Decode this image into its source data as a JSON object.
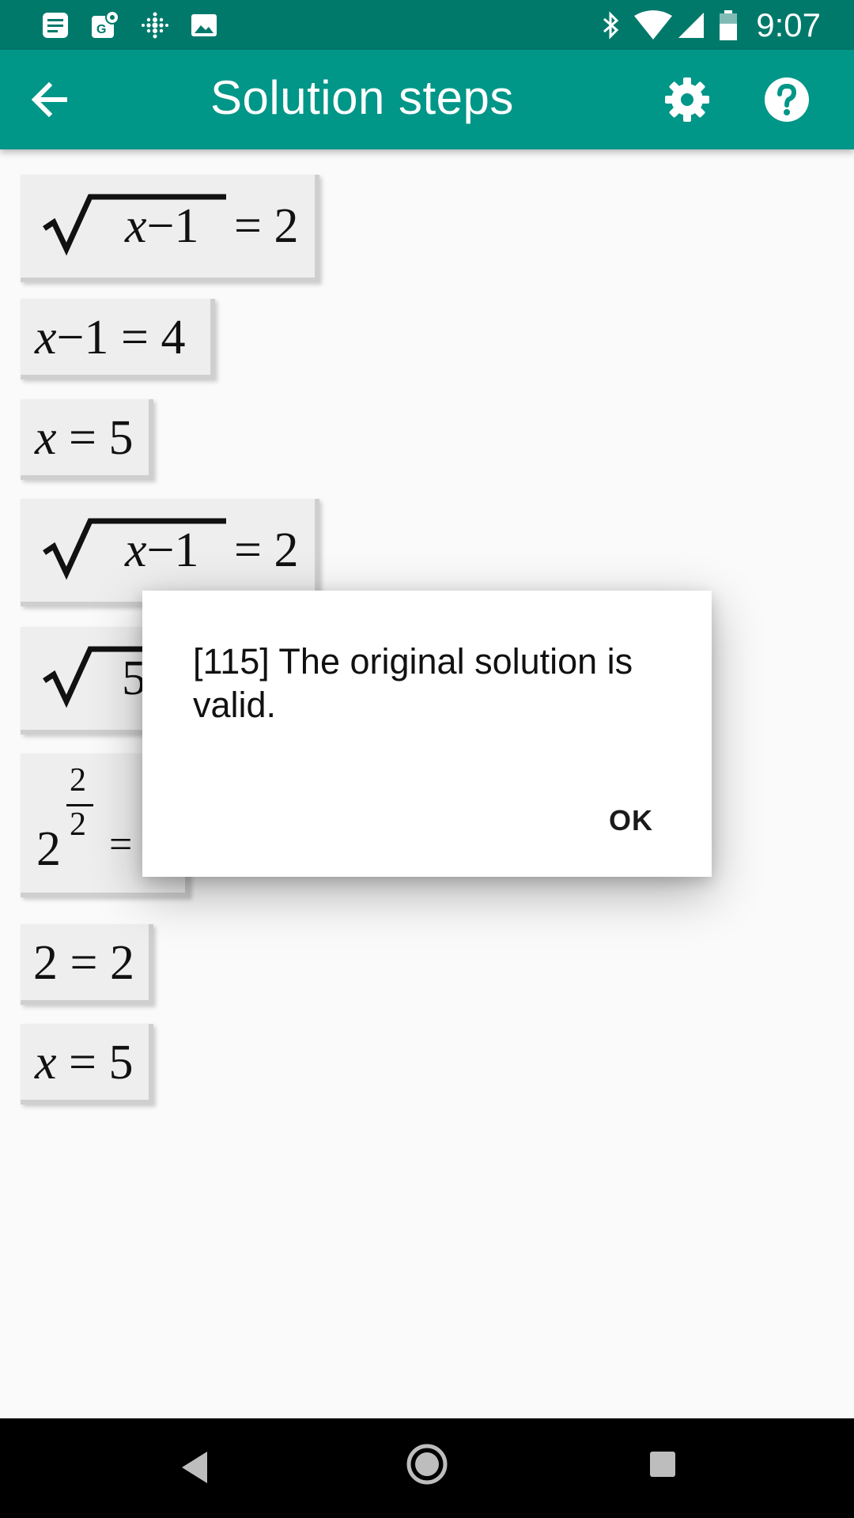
{
  "status_bar": {
    "time": "9:07",
    "left_icons": [
      "notes-icon",
      "maps-icon",
      "fitbit-icon",
      "image-icon"
    ],
    "right_icons": [
      "bluetooth-icon",
      "wifi-icon",
      "signal-icon",
      "battery-icon"
    ]
  },
  "app_bar": {
    "title": "Solution steps"
  },
  "steps": [
    {
      "var": "x",
      "rest": "−1",
      "rhs": "= 2"
    },
    {
      "var": "x",
      "rest": "−1 = 4"
    },
    {
      "var": "x",
      "rest": " = 5"
    },
    {
      "var": "x",
      "rest": "−1",
      "rhs": "= 2"
    },
    {
      "rad": "5"
    },
    {
      "base": "2",
      "num": "2",
      "den": "2",
      "eq": "="
    },
    {
      "text": "2 = 2"
    },
    {
      "var": "x",
      "rest": " = 5"
    }
  ],
  "dialog": {
    "message": "[115] The original solution is valid.",
    "ok_label": "OK"
  },
  "colors": {
    "status_bar": "#00796b",
    "app_bar": "#009688"
  }
}
